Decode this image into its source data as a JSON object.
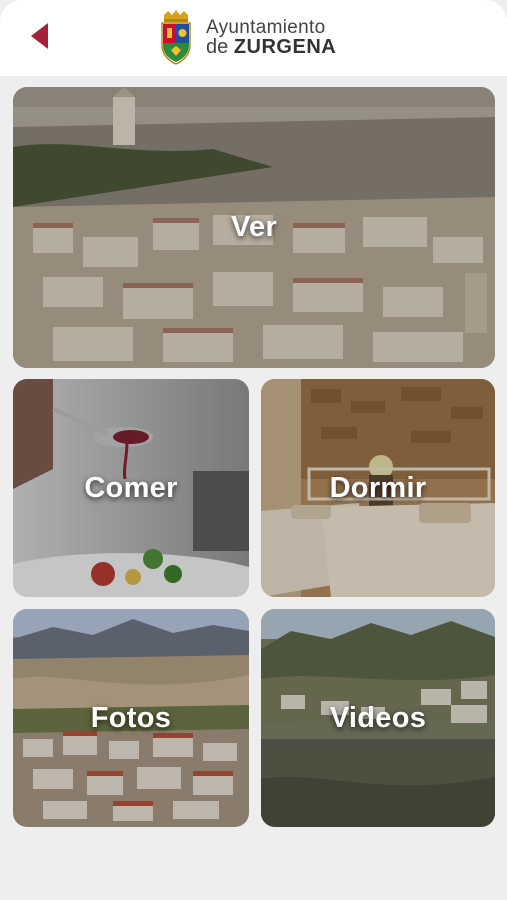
{
  "header": {
    "brand_line1": "Ayuntamiento",
    "brand_line2_prefix": "de ",
    "brand_line2_name": "ZURGENA",
    "accent_color": "#a3213a"
  },
  "tiles": [
    {
      "label": "Ver",
      "image": "town-panorama"
    },
    {
      "label": "Comer",
      "image": "food-plating"
    },
    {
      "label": "Dormir",
      "image": "hotel-room"
    },
    {
      "label": "Fotos",
      "image": "town-hillside"
    },
    {
      "label": "Videos",
      "image": "mountain-valley"
    }
  ],
  "icons": {
    "back": "back-arrow-icon",
    "coat_of_arms": "coat-of-arms-icon"
  }
}
